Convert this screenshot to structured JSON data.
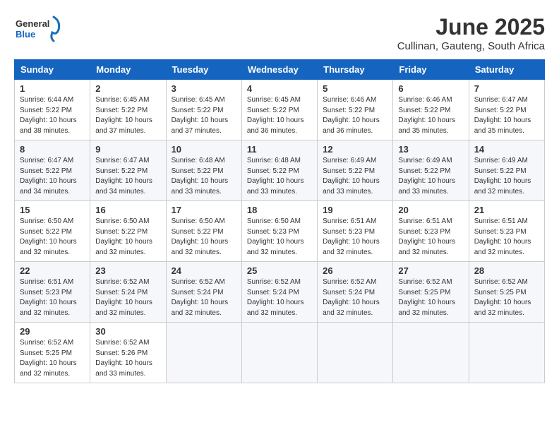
{
  "header": {
    "logo_general": "General",
    "logo_blue": "Blue",
    "month": "June 2025",
    "location": "Cullinan, Gauteng, South Africa"
  },
  "weekdays": [
    "Sunday",
    "Monday",
    "Tuesday",
    "Wednesday",
    "Thursday",
    "Friday",
    "Saturday"
  ],
  "weeks": [
    [
      {
        "day": "1",
        "sunrise": "Sunrise: 6:44 AM",
        "sunset": "Sunset: 5:22 PM",
        "daylight": "Daylight: 10 hours and 38 minutes."
      },
      {
        "day": "2",
        "sunrise": "Sunrise: 6:45 AM",
        "sunset": "Sunset: 5:22 PM",
        "daylight": "Daylight: 10 hours and 37 minutes."
      },
      {
        "day": "3",
        "sunrise": "Sunrise: 6:45 AM",
        "sunset": "Sunset: 5:22 PM",
        "daylight": "Daylight: 10 hours and 37 minutes."
      },
      {
        "day": "4",
        "sunrise": "Sunrise: 6:45 AM",
        "sunset": "Sunset: 5:22 PM",
        "daylight": "Daylight: 10 hours and 36 minutes."
      },
      {
        "day": "5",
        "sunrise": "Sunrise: 6:46 AM",
        "sunset": "Sunset: 5:22 PM",
        "daylight": "Daylight: 10 hours and 36 minutes."
      },
      {
        "day": "6",
        "sunrise": "Sunrise: 6:46 AM",
        "sunset": "Sunset: 5:22 PM",
        "daylight": "Daylight: 10 hours and 35 minutes."
      },
      {
        "day": "7",
        "sunrise": "Sunrise: 6:47 AM",
        "sunset": "Sunset: 5:22 PM",
        "daylight": "Daylight: 10 hours and 35 minutes."
      }
    ],
    [
      {
        "day": "8",
        "sunrise": "Sunrise: 6:47 AM",
        "sunset": "Sunset: 5:22 PM",
        "daylight": "Daylight: 10 hours and 34 minutes."
      },
      {
        "day": "9",
        "sunrise": "Sunrise: 6:47 AM",
        "sunset": "Sunset: 5:22 PM",
        "daylight": "Daylight: 10 hours and 34 minutes."
      },
      {
        "day": "10",
        "sunrise": "Sunrise: 6:48 AM",
        "sunset": "Sunset: 5:22 PM",
        "daylight": "Daylight: 10 hours and 33 minutes."
      },
      {
        "day": "11",
        "sunrise": "Sunrise: 6:48 AM",
        "sunset": "Sunset: 5:22 PM",
        "daylight": "Daylight: 10 hours and 33 minutes."
      },
      {
        "day": "12",
        "sunrise": "Sunrise: 6:49 AM",
        "sunset": "Sunset: 5:22 PM",
        "daylight": "Daylight: 10 hours and 33 minutes."
      },
      {
        "day": "13",
        "sunrise": "Sunrise: 6:49 AM",
        "sunset": "Sunset: 5:22 PM",
        "daylight": "Daylight: 10 hours and 33 minutes."
      },
      {
        "day": "14",
        "sunrise": "Sunrise: 6:49 AM",
        "sunset": "Sunset: 5:22 PM",
        "daylight": "Daylight: 10 hours and 32 minutes."
      }
    ],
    [
      {
        "day": "15",
        "sunrise": "Sunrise: 6:50 AM",
        "sunset": "Sunset: 5:22 PM",
        "daylight": "Daylight: 10 hours and 32 minutes."
      },
      {
        "day": "16",
        "sunrise": "Sunrise: 6:50 AM",
        "sunset": "Sunset: 5:22 PM",
        "daylight": "Daylight: 10 hours and 32 minutes."
      },
      {
        "day": "17",
        "sunrise": "Sunrise: 6:50 AM",
        "sunset": "Sunset: 5:22 PM",
        "daylight": "Daylight: 10 hours and 32 minutes."
      },
      {
        "day": "18",
        "sunrise": "Sunrise: 6:50 AM",
        "sunset": "Sunset: 5:23 PM",
        "daylight": "Daylight: 10 hours and 32 minutes."
      },
      {
        "day": "19",
        "sunrise": "Sunrise: 6:51 AM",
        "sunset": "Sunset: 5:23 PM",
        "daylight": "Daylight: 10 hours and 32 minutes."
      },
      {
        "day": "20",
        "sunrise": "Sunrise: 6:51 AM",
        "sunset": "Sunset: 5:23 PM",
        "daylight": "Daylight: 10 hours and 32 minutes."
      },
      {
        "day": "21",
        "sunrise": "Sunrise: 6:51 AM",
        "sunset": "Sunset: 5:23 PM",
        "daylight": "Daylight: 10 hours and 32 minutes."
      }
    ],
    [
      {
        "day": "22",
        "sunrise": "Sunrise: 6:51 AM",
        "sunset": "Sunset: 5:23 PM",
        "daylight": "Daylight: 10 hours and 32 minutes."
      },
      {
        "day": "23",
        "sunrise": "Sunrise: 6:52 AM",
        "sunset": "Sunset: 5:24 PM",
        "daylight": "Daylight: 10 hours and 32 minutes."
      },
      {
        "day": "24",
        "sunrise": "Sunrise: 6:52 AM",
        "sunset": "Sunset: 5:24 PM",
        "daylight": "Daylight: 10 hours and 32 minutes."
      },
      {
        "day": "25",
        "sunrise": "Sunrise: 6:52 AM",
        "sunset": "Sunset: 5:24 PM",
        "daylight": "Daylight: 10 hours and 32 minutes."
      },
      {
        "day": "26",
        "sunrise": "Sunrise: 6:52 AM",
        "sunset": "Sunset: 5:24 PM",
        "daylight": "Daylight: 10 hours and 32 minutes."
      },
      {
        "day": "27",
        "sunrise": "Sunrise: 6:52 AM",
        "sunset": "Sunset: 5:25 PM",
        "daylight": "Daylight: 10 hours and 32 minutes."
      },
      {
        "day": "28",
        "sunrise": "Sunrise: 6:52 AM",
        "sunset": "Sunset: 5:25 PM",
        "daylight": "Daylight: 10 hours and 32 minutes."
      }
    ],
    [
      {
        "day": "29",
        "sunrise": "Sunrise: 6:52 AM",
        "sunset": "Sunset: 5:25 PM",
        "daylight": "Daylight: 10 hours and 32 minutes."
      },
      {
        "day": "30",
        "sunrise": "Sunrise: 6:52 AM",
        "sunset": "Sunset: 5:26 PM",
        "daylight": "Daylight: 10 hours and 33 minutes."
      },
      null,
      null,
      null,
      null,
      null
    ]
  ]
}
